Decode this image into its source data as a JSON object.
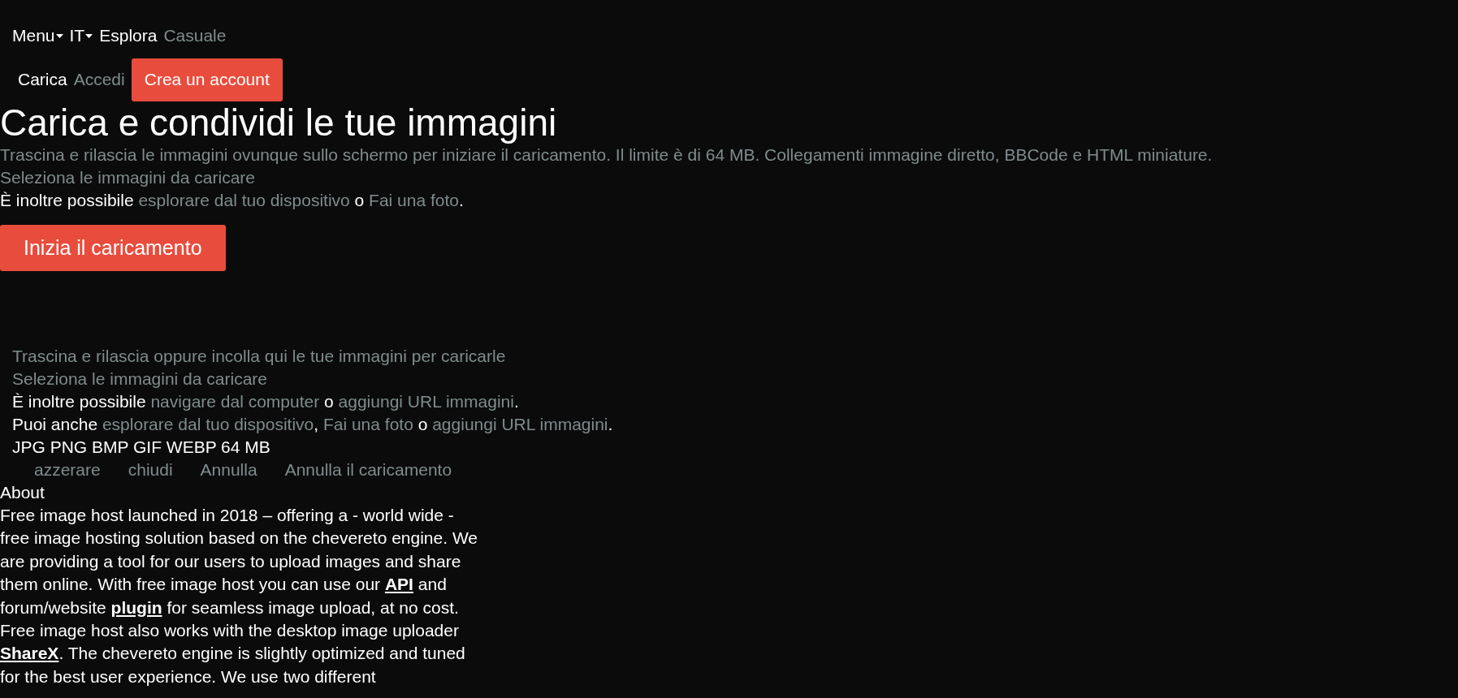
{
  "nav": {
    "items": [
      {
        "label": "Menu",
        "kind": "dropdown"
      },
      {
        "label": "IT",
        "kind": "dropdown"
      },
      {
        "label": "Esplora",
        "kind": "link"
      },
      {
        "label": "Casuale",
        "kind": "muted"
      }
    ],
    "user_items": [
      {
        "label": "Carica",
        "kind": "link"
      },
      {
        "label": "Accedi",
        "kind": "muted"
      },
      {
        "label": "Crea un account",
        "kind": "button"
      }
    ]
  },
  "hero": {
    "title": "Carica e condividi le tue immagini",
    "subtitle": "Trascina e rilascia le immagini ovunque sullo schermo per iniziare il caricamento. Il limite è di 64 MB. Collegamenti immagine diretto, BBCode e HTML miniature.",
    "select_link": "Seleziona le immagini da caricare",
    "options": [
      {
        "text": "È inoltre possibile ",
        "kind": "text"
      },
      {
        "text": "esplorare dal tuo dispositivo",
        "kind": "link"
      },
      {
        "text": " o ",
        "kind": "text"
      },
      {
        "text": "Fai una foto",
        "kind": "link"
      },
      {
        "text": ".",
        "kind": "text"
      }
    ],
    "start_button": "Inizia il caricamento"
  },
  "dropzone": {
    "heading": "Trascina e rilascia oppure incolla qui le tue immagini per caricarle",
    "select_link": "Seleziona le immagini da caricare",
    "lines": [
      [
        {
          "text": "È inoltre possibile ",
          "kind": "text"
        },
        {
          "text": "navigare dal computer",
          "kind": "link"
        },
        {
          "text": " o ",
          "kind": "text"
        },
        {
          "text": "aggiungi URL immagini",
          "kind": "link"
        },
        {
          "text": ".",
          "kind": "text"
        }
      ],
      [
        {
          "text": "Puoi anche ",
          "kind": "text"
        },
        {
          "text": "esplorare dal tuo dispositivo",
          "kind": "link"
        },
        {
          "text": ", ",
          "kind": "text"
        },
        {
          "text": "Fai una foto",
          "kind": "link"
        },
        {
          "text": " o ",
          "kind": "text"
        },
        {
          "text": "aggiungi URL immagini",
          "kind": "link"
        },
        {
          "text": ".",
          "kind": "text"
        }
      ]
    ],
    "formats": "JPG PNG BMP GIF WEBP 64 MB",
    "actions": [
      "azzerare",
      "chiudi",
      "Annulla",
      "Annulla il caricamento"
    ]
  },
  "about": {
    "title": "About",
    "body": [
      {
        "text": "Free image host launched in 2018 – offering a - world wide - free image hosting solution based on the chevereto engine. We are providing a tool for our users to upload images and share them online. With free image host you can use our ",
        "kind": "text"
      },
      {
        "text": "API",
        "kind": "link"
      },
      {
        "text": " and forum/website ",
        "kind": "text"
      },
      {
        "text": "plugin",
        "kind": "link"
      },
      {
        "text": " for seamless image upload, at no cost. Free image host also works with the desktop image uploader ",
        "kind": "text"
      },
      {
        "text": "ShareX",
        "kind": "link"
      },
      {
        "text": ". The chevereto engine is slightly optimized and tuned for the best user experience. We use two different",
        "kind": "text"
      }
    ]
  }
}
